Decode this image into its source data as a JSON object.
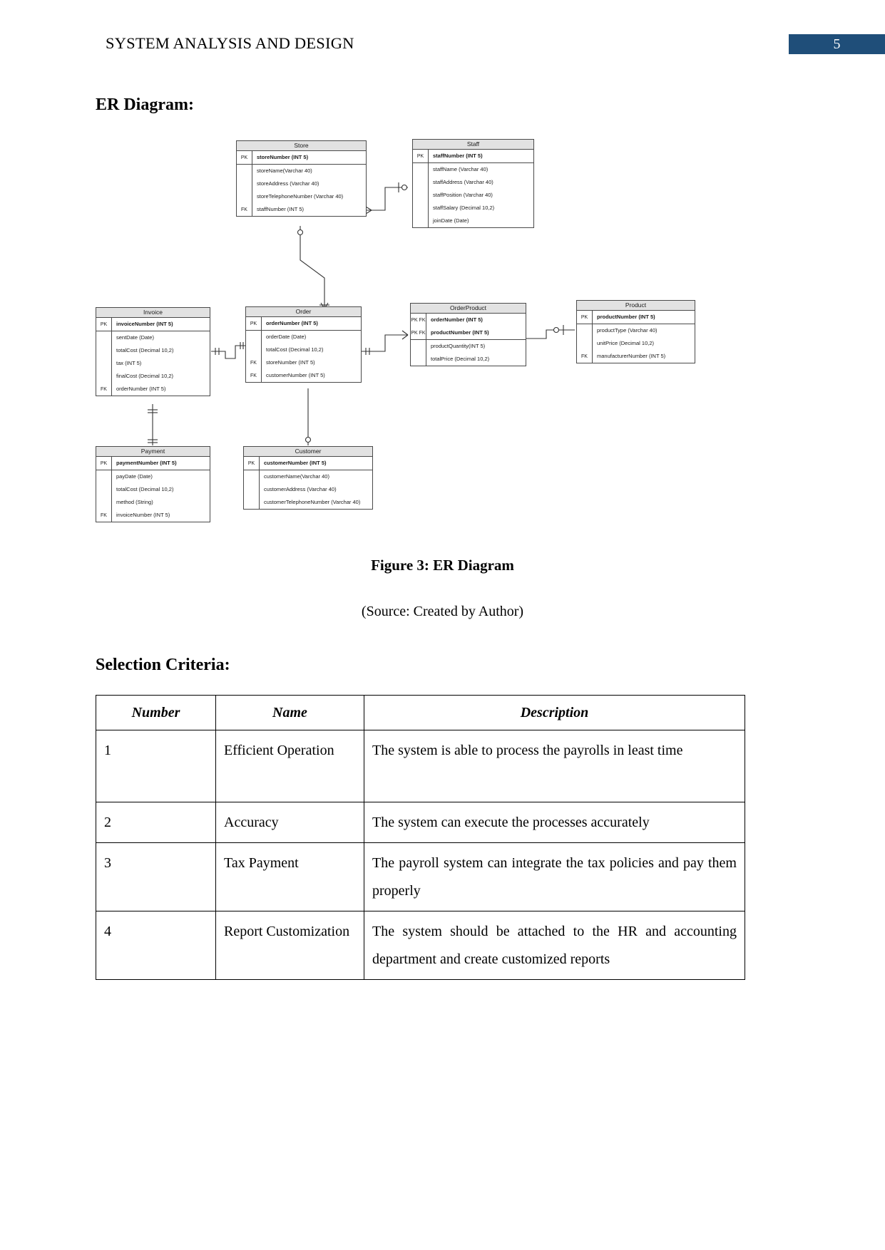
{
  "header": {
    "title": "SYSTEM ANALYSIS AND DESIGN",
    "page_number": "5",
    "badge_color": "#1f4e79"
  },
  "sections": {
    "er_heading": "ER Diagram:",
    "figure_caption": "Figure 3: ER Diagram",
    "source_note": "(Source: Created by Author)",
    "selection_heading": "Selection Criteria:"
  },
  "er_diagram": {
    "entities": [
      {
        "name": "Store",
        "rows": [
          {
            "key": "PK",
            "attr": "storeNumber (INT 5)",
            "bold": true
          },
          {
            "key": "",
            "attr": "storeName(Varchar 40)",
            "bold": false
          },
          {
            "key": "",
            "attr": "storeAddress (Varchar 40)",
            "bold": false
          },
          {
            "key": "",
            "attr": "storeTelephoneNumber (Varchar 40)",
            "bold": false
          },
          {
            "key": "FK",
            "attr": "staffNumber (INT 5)",
            "bold": false
          }
        ]
      },
      {
        "name": "Staff",
        "rows": [
          {
            "key": "PK",
            "attr": "staffNumber (INT 5)",
            "bold": true
          },
          {
            "key": "",
            "attr": "staffName (Varchar 40)",
            "bold": false
          },
          {
            "key": "",
            "attr": "staffAddress (Varchar 40)",
            "bold": false
          },
          {
            "key": "",
            "attr": "staffPosition (Varchar 40)",
            "bold": false
          },
          {
            "key": "",
            "attr": "staffSalary (Decimal 10,2)",
            "bold": false
          },
          {
            "key": "",
            "attr": "joinDate (Date)",
            "bold": false
          }
        ]
      },
      {
        "name": "Invoice",
        "rows": [
          {
            "key": "PK",
            "attr": "invoiceNumber (INT 5)",
            "bold": true
          },
          {
            "key": "",
            "attr": "sentDate (Date)",
            "bold": false
          },
          {
            "key": "",
            "attr": "totalCost (Decimal 10,2)",
            "bold": false
          },
          {
            "key": "",
            "attr": "tax (INT 5)",
            "bold": false
          },
          {
            "key": "",
            "attr": "finalCost (Decimal 10,2)",
            "bold": false
          },
          {
            "key": "FK",
            "attr": "orderNumber (INT 5)",
            "bold": false
          }
        ]
      },
      {
        "name": "Order",
        "rows": [
          {
            "key": "PK",
            "attr": "orderNumber (INT 5)",
            "bold": true
          },
          {
            "key": "",
            "attr": "orderDate (Date)",
            "bold": false
          },
          {
            "key": "",
            "attr": "totalCost (Decimal 10,2)",
            "bold": false
          },
          {
            "key": "FK",
            "attr": "storeNumber (INT 5)",
            "bold": false
          },
          {
            "key": "FK",
            "attr": "customerNumber (INT 5)",
            "bold": false
          }
        ]
      },
      {
        "name": "OrderProduct",
        "rows": [
          {
            "key": "PK FK",
            "attr": "orderNumber (INT 5)",
            "bold": true
          },
          {
            "key": "PK FK",
            "attr": "productNumber (INT 5)",
            "bold": true
          },
          {
            "key": "",
            "attr": "productQuantity(INT 5)",
            "bold": false
          },
          {
            "key": "",
            "attr": "totalPrice (Decimal 10,2)",
            "bold": false
          }
        ]
      },
      {
        "name": "Product",
        "rows": [
          {
            "key": "PK",
            "attr": "productNumber (INT 5)",
            "bold": true
          },
          {
            "key": "",
            "attr": "productType (Varchar 40)",
            "bold": false
          },
          {
            "key": "",
            "attr": "unitPrice (Decimal 10,2)",
            "bold": false
          },
          {
            "key": "FK",
            "attr": "manufacturerNumber (INT 5)",
            "bold": false
          }
        ]
      },
      {
        "name": "Payment",
        "rows": [
          {
            "key": "PK",
            "attr": "paymentNumber (INT 5)",
            "bold": true
          },
          {
            "key": "",
            "attr": "payDate (Date)",
            "bold": false
          },
          {
            "key": "",
            "attr": "totalCost (Decimal 10,2)",
            "bold": false
          },
          {
            "key": "",
            "attr": "method (String)",
            "bold": false
          },
          {
            "key": "FK",
            "attr": "invoiceNumber (INT 5)",
            "bold": false
          }
        ]
      },
      {
        "name": "Customer",
        "rows": [
          {
            "key": "PK",
            "attr": "customerNumber (INT 5)",
            "bold": true
          },
          {
            "key": "",
            "attr": "customerName(Varchar 40)",
            "bold": false
          },
          {
            "key": "",
            "attr": "customerAddress (Varchar 40)",
            "bold": false
          },
          {
            "key": "",
            "attr": "customerTelephoneNumber (Varchar 40)",
            "bold": false
          }
        ]
      }
    ]
  },
  "criteria_table": {
    "headers": [
      "Number",
      "Name",
      "Description"
    ],
    "rows": [
      {
        "number": "1",
        "name": "Efficient Operation",
        "description": "The system is able to process the payrolls in least time"
      },
      {
        "number": "2",
        "name": "Accuracy",
        "description": "The system can execute the processes accurately"
      },
      {
        "number": "3",
        "name": "Tax Payment",
        "description": "The payroll system can integrate the tax policies and pay them properly"
      },
      {
        "number": "4",
        "name": "Report Customization",
        "description": "The system should be attached to the HR and accounting department and create customized reports"
      }
    ]
  }
}
